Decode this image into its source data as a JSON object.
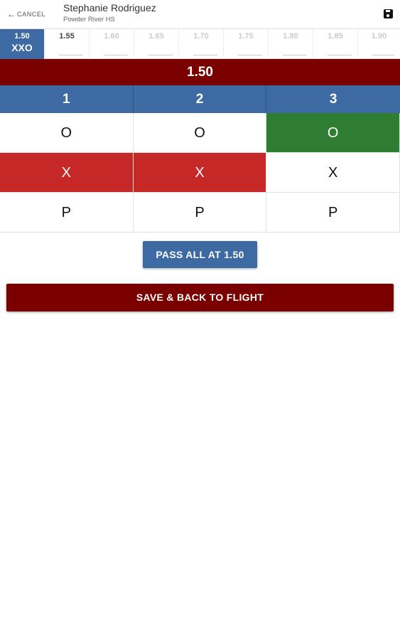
{
  "header": {
    "cancel_label": "CANCEL",
    "athlete_name": "Stephanie Rodriguez",
    "athlete_school": "Powder River HS",
    "save_icon": "floppy-disk-icon"
  },
  "heights": [
    {
      "value": "1.50",
      "result": "XXO",
      "state": "active"
    },
    {
      "value": "1.55",
      "result": "",
      "state": "next"
    },
    {
      "value": "1.60",
      "result": "",
      "state": "future"
    },
    {
      "value": "1.65",
      "result": "",
      "state": "future"
    },
    {
      "value": "1.70",
      "result": "",
      "state": "future"
    },
    {
      "value": "1.75",
      "result": "",
      "state": "future"
    },
    {
      "value": "1.80",
      "result": "",
      "state": "future"
    },
    {
      "value": "1.85",
      "result": "",
      "state": "future"
    },
    {
      "value": "1.90",
      "result": "",
      "state": "future"
    }
  ],
  "current_height": "1.50",
  "attempts": {
    "headers": [
      "1",
      "2",
      "3"
    ],
    "o_row": [
      "O",
      "O",
      "O"
    ],
    "x_row": [
      "X",
      "X",
      "X"
    ],
    "p_row": [
      "P",
      "P",
      "P"
    ]
  },
  "buttons": {
    "pass_all": "PASS ALL AT 1.50",
    "save_back": "SAVE & BACK TO FLIGHT"
  },
  "colors": {
    "primary_blue": "#3e6aa3",
    "banner_red": "#7a0000",
    "success_green": "#2e7d32",
    "fail_red": "#c62828"
  }
}
